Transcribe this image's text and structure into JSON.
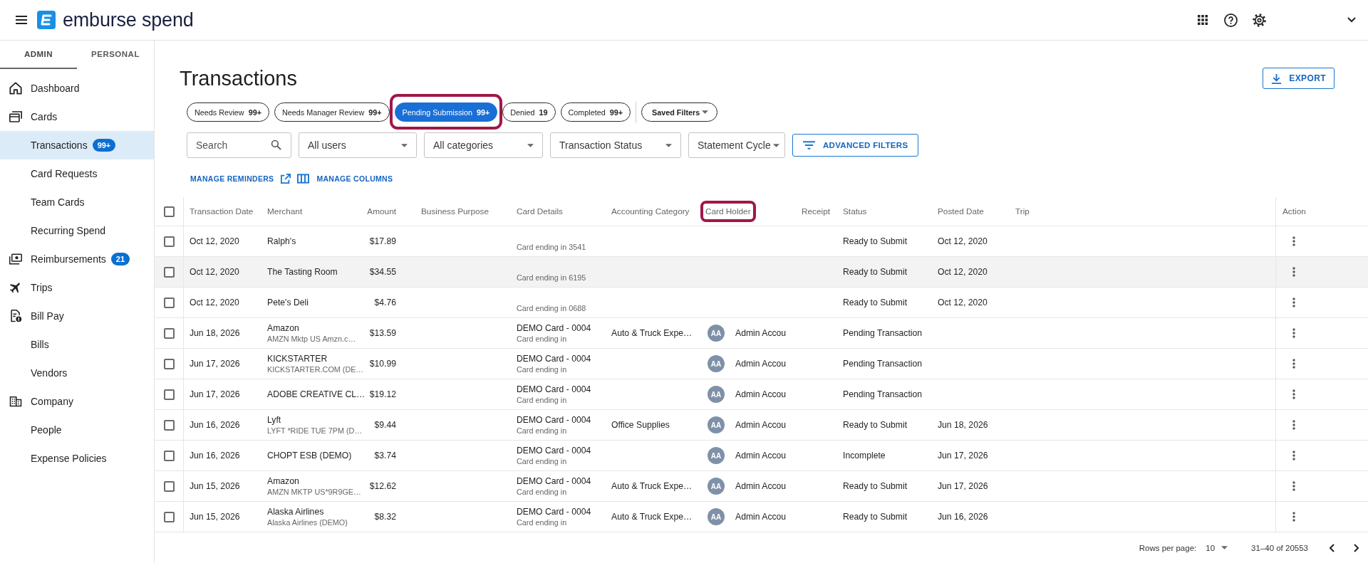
{
  "header": {
    "logo_text": "emburse spend"
  },
  "sidebar": {
    "tabs": [
      {
        "label": "ADMIN",
        "selected": true
      },
      {
        "label": "PERSONAL",
        "selected": false
      }
    ],
    "items": [
      {
        "label": "Dashboard",
        "selected": false
      },
      {
        "label": "Cards",
        "selected": false,
        "children": [
          {
            "label": "Transactions",
            "selected": true,
            "badge": "99+"
          },
          {
            "label": "Card Requests",
            "selected": false
          },
          {
            "label": "Team Cards",
            "selected": false
          },
          {
            "label": "Recurring Spend",
            "selected": false
          }
        ]
      },
      {
        "label": "Reimbursements",
        "selected": false,
        "badge": "21"
      },
      {
        "label": "Trips",
        "selected": false
      },
      {
        "label": "Bill Pay",
        "selected": false,
        "children": [
          {
            "label": "Bills",
            "selected": false
          },
          {
            "label": "Vendors",
            "selected": false
          }
        ]
      },
      {
        "label": "Company",
        "selected": false,
        "children": [
          {
            "label": "People",
            "selected": false
          },
          {
            "label": "Expense Policies",
            "selected": false
          }
        ]
      }
    ]
  },
  "page": {
    "title": "Transactions",
    "export_button": "EXPORT"
  },
  "status_chips": [
    {
      "label": "Needs Review",
      "count": "99+",
      "selected": false
    },
    {
      "label": "Needs Manager Review",
      "count": "99+",
      "selected": false
    },
    {
      "label": "Pending Submission",
      "count": "99+",
      "selected": true,
      "highlighted": true
    },
    {
      "label": "Denied",
      "count": "19",
      "selected": false
    },
    {
      "label": "Completed",
      "count": "99+",
      "selected": false
    }
  ],
  "saved_filters": "Saved Filters",
  "filters": [
    {
      "kind": "search",
      "placeholder": "Search"
    },
    {
      "kind": "select",
      "value": "All users"
    },
    {
      "kind": "select",
      "value": "All categories"
    },
    {
      "kind": "select",
      "value": "Transaction Status"
    },
    {
      "kind": "select",
      "value": "Statement Cycle"
    }
  ],
  "advanced_filters_button": "ADVANCED FILTERS",
  "links": [
    "MANAGE REMINDERS",
    "MANAGE COLUMNS"
  ],
  "table": {
    "header_checked": false,
    "columns": [
      {
        "label": "Transaction Date"
      },
      {
        "label": "Merchant"
      },
      {
        "label": "Amount"
      },
      {
        "label": "Business Purpose"
      },
      {
        "label": "Card Details"
      },
      {
        "label": "Accounting Category"
      },
      {
        "label": "Card Holder",
        "highlighted": true
      },
      {
        "label": "Receipt"
      },
      {
        "label": "Status"
      },
      {
        "label": "Posted Date"
      },
      {
        "label": "Trip"
      },
      {
        "label": "Action"
      }
    ],
    "rows": [
      {
        "date": "Oct 12, 2020",
        "merchant": "Ralph's",
        "amount": "$17.89",
        "card_ending": "Card ending in 3541",
        "status": "Ready to Submit",
        "posted_date": "Oct 12, 2020",
        "checked": false,
        "hovered": false
      },
      {
        "date": "Oct 12, 2020",
        "merchant": "The Tasting Room",
        "amount": "$34.55",
        "card_ending": "Card ending in 6195",
        "status": "Ready to Submit",
        "posted_date": "Oct 12, 2020",
        "checked": false,
        "hovered": true
      },
      {
        "date": "Oct 12, 2020",
        "merchant": "Pete's Deli",
        "amount": "$4.76",
        "card_ending": "Card ending in 0688",
        "status": "Ready to Submit",
        "posted_date": "Oct 12, 2020",
        "checked": false,
        "hovered": false
      },
      {
        "date": "Jun 18, 2026",
        "merchant": "Amazon",
        "merchant_detail": "AMZN Mktp US Amzn.c…",
        "amount": "$13.59",
        "card_name": "DEMO Card - 0004",
        "card_ending": "Card ending in",
        "category": "Auto & Truck Expe…",
        "holder_initials": "AA",
        "holder_name": "Admin Accou",
        "status": "Pending Transaction",
        "checked": false,
        "hovered": false
      },
      {
        "date": "Jun 17, 2026",
        "merchant": "KICKSTARTER",
        "merchant_detail": "KICKSTARTER.COM (DE…",
        "amount": "$10.99",
        "card_name": "DEMO Card - 0004",
        "card_ending": "Card ending in",
        "holder_initials": "AA",
        "holder_name": "Admin Accou",
        "status": "Pending Transaction",
        "checked": false,
        "hovered": false
      },
      {
        "date": "Jun 17, 2026",
        "merchant": "ADOBE CREATIVE CL…",
        "amount": "$19.12",
        "card_name": "DEMO Card - 0004",
        "card_ending": "Card ending in",
        "holder_initials": "AA",
        "holder_name": "Admin Accou",
        "status": "Pending Transaction",
        "checked": false,
        "hovered": false
      },
      {
        "date": "Jun 16, 2026",
        "merchant": "Lyft",
        "merchant_detail": "LYFT *RIDE TUE 7PM (D…",
        "amount": "$9.44",
        "card_name": "DEMO Card - 0004",
        "card_ending": "Card ending in",
        "category": "Office Supplies",
        "holder_initials": "AA",
        "holder_name": "Admin Accou",
        "status": "Ready to Submit",
        "posted_date": "Jun 18, 2026",
        "checked": false,
        "hovered": false
      },
      {
        "date": "Jun 16, 2026",
        "merchant": "CHOPT ESB (DEMO)",
        "amount": "$3.74",
        "card_name": "DEMO Card - 0004",
        "card_ending": "Card ending in",
        "holder_initials": "AA",
        "holder_name": "Admin Accou",
        "status": "Incomplete",
        "posted_date": "Jun 17, 2026",
        "checked": false,
        "hovered": false
      },
      {
        "date": "Jun 15, 2026",
        "merchant": "Amazon",
        "merchant_detail": "AMZN MKTP US*9R9GE…",
        "amount": "$12.62",
        "card_name": "DEMO Card - 0004",
        "card_ending": "Card ending in",
        "category": "Auto & Truck Expe…",
        "holder_initials": "AA",
        "holder_name": "Admin Accou",
        "status": "Ready to Submit",
        "posted_date": "Jun 17, 2026",
        "checked": false,
        "hovered": false
      },
      {
        "date": "Jun 15, 2026",
        "merchant": "Alaska Airlines",
        "merchant_detail": "Alaska Airlines (DEMO)",
        "amount": "$8.32",
        "card_name": "DEMO Card - 0004",
        "card_ending": "Card ending in",
        "category": "Auto & Truck Expe…",
        "holder_initials": "AA",
        "holder_name": "Admin Accou",
        "status": "Ready to Submit",
        "posted_date": "Jun 16, 2026",
        "checked": false,
        "hovered": false
      }
    ]
  },
  "pagination": {
    "rows_per_page_label": "Rows per page:",
    "rows_per_page": "10",
    "range": "31–40 of 20553"
  }
}
